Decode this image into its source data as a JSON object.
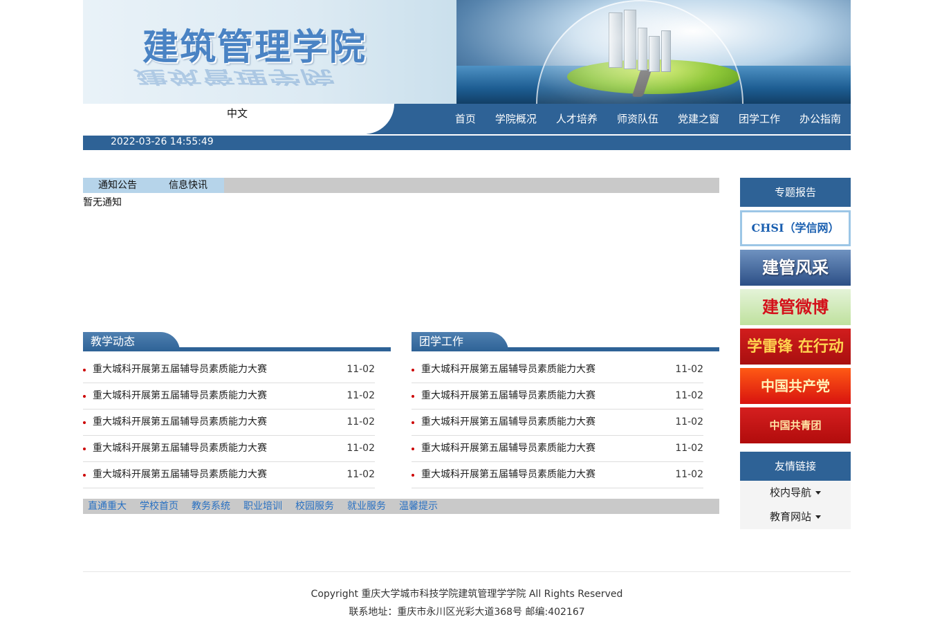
{
  "header": {
    "title": "建筑管理学院",
    "lang": "中文",
    "nav": [
      "首页",
      "学院概况",
      "人才培养",
      "师资队伍",
      "党建之窗",
      "团学工作",
      "办公指南"
    ],
    "datetime": "2022-03-26 14:55:49"
  },
  "notice": {
    "tabs": [
      "通知公告",
      "信息快讯"
    ],
    "empty": "暂无通知"
  },
  "teaching": {
    "title": "教学动态",
    "items": [
      {
        "text": "重大城科开展第五届辅导员素质能力大赛",
        "date": "11-02"
      },
      {
        "text": "重大城科开展第五届辅导员素质能力大赛",
        "date": "11-02"
      },
      {
        "text": "重大城科开展第五届辅导员素质能力大赛",
        "date": "11-02"
      },
      {
        "text": "重大城科开展第五届辅导员素质能力大赛",
        "date": "11-02"
      },
      {
        "text": "重大城科开展第五届辅导员素质能力大赛",
        "date": "11-02"
      }
    ]
  },
  "youth": {
    "title": "团学工作",
    "items": [
      {
        "text": "重大城科开展第五届辅导员素质能力大赛",
        "date": "11-02"
      },
      {
        "text": "重大城科开展第五届辅导员素质能力大赛",
        "date": "11-02"
      },
      {
        "text": "重大城科开展第五届辅导员素质能力大赛",
        "date": "11-02"
      },
      {
        "text": "重大城科开展第五届辅导员素质能力大赛",
        "date": "11-02"
      },
      {
        "text": "重大城科开展第五届辅导员素质能力大赛",
        "date": "11-02"
      }
    ]
  },
  "links": [
    "直通重大",
    "学校首页",
    "教务系统",
    "职业培训",
    "校园服务",
    "就业服务",
    "温馨提示"
  ],
  "sidebar": {
    "special_title": "专题报告",
    "banners": [
      "CHSI（学信网）",
      "建管风采",
      "建管微博",
      "学雷锋 在行动",
      "中国共产党",
      "中国共青团"
    ],
    "friend_title": "友情链接",
    "dropdowns": [
      "校内导航",
      "教育网站"
    ]
  },
  "footer": {
    "copyright": "Copyright 重庆大学城市科技学院建筑管理学学院 All Rights Reserved",
    "address": "联系地址：重庆市永川区光彩大道368号 邮编:402167"
  }
}
